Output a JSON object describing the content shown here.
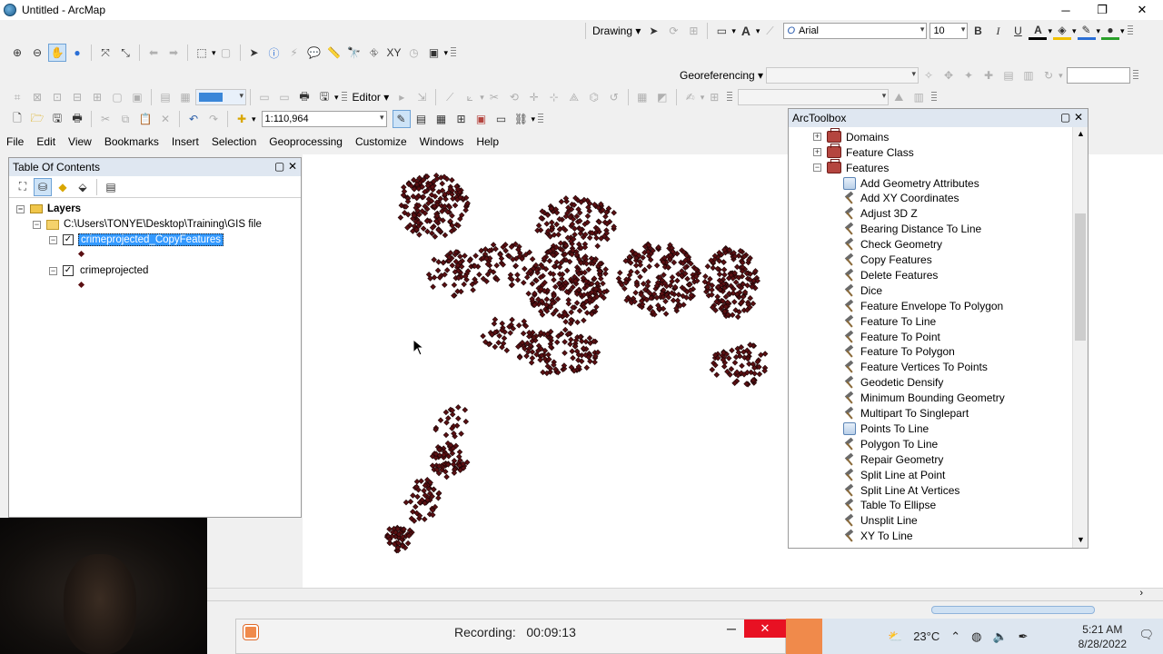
{
  "window": {
    "title": "Untitled - ArcMap",
    "minimize": "─",
    "restore": "❐",
    "close": "✕"
  },
  "drawing_toolbar": {
    "drawing_label": "Drawing",
    "font_name": "Arial",
    "font_size": "10",
    "bold": "B",
    "italic": "I",
    "underline": "U"
  },
  "georef_toolbar": {
    "label": "Georeferencing"
  },
  "editor_toolbar": {
    "label": "Editor"
  },
  "standard_toolbar": {
    "scale": "1:110,964"
  },
  "menu": [
    "File",
    "Edit",
    "View",
    "Bookmarks",
    "Insert",
    "Selection",
    "Geoprocessing",
    "Customize",
    "Windows",
    "Help"
  ],
  "toc": {
    "title": "Table Of Contents",
    "layers_root": "Layers",
    "folder_path": "C:\\Users\\TONYE\\Desktop\\Training\\GIS file",
    "layers": [
      {
        "name": "crimeprojected_CopyFeatures",
        "checked": true,
        "selected": true
      },
      {
        "name": "crimeprojected",
        "checked": true,
        "selected": false
      }
    ]
  },
  "arctoolbox": {
    "title": "ArcToolbox",
    "toolsets": [
      {
        "name": "Domains",
        "expanded": false
      },
      {
        "name": "Feature Class",
        "expanded": false
      },
      {
        "name": "Features",
        "expanded": true
      }
    ],
    "tools": [
      {
        "name": "Add Geometry Attributes",
        "icon": "script-icon"
      },
      {
        "name": "Add XY Coordinates",
        "icon": "hammer-icon"
      },
      {
        "name": "Adjust 3D Z",
        "icon": "hammer-icon"
      },
      {
        "name": "Bearing Distance To Line",
        "icon": "hammer-icon"
      },
      {
        "name": "Check Geometry",
        "icon": "hammer-icon"
      },
      {
        "name": "Copy Features",
        "icon": "hammer-icon"
      },
      {
        "name": "Delete Features",
        "icon": "hammer-icon"
      },
      {
        "name": "Dice",
        "icon": "hammer-icon"
      },
      {
        "name": "Feature Envelope To Polygon",
        "icon": "hammer-icon"
      },
      {
        "name": "Feature To Line",
        "icon": "hammer-icon"
      },
      {
        "name": "Feature To Point",
        "icon": "hammer-icon"
      },
      {
        "name": "Feature To Polygon",
        "icon": "hammer-icon"
      },
      {
        "name": "Feature Vertices To Points",
        "icon": "hammer-icon"
      },
      {
        "name": "Geodetic Densify",
        "icon": "hammer-icon"
      },
      {
        "name": "Minimum Bounding Geometry",
        "icon": "hammer-icon"
      },
      {
        "name": "Multipart To Singlepart",
        "icon": "hammer-icon"
      },
      {
        "name": "Points To Line",
        "icon": "script-icon"
      },
      {
        "name": "Polygon To Line",
        "icon": "hammer-icon"
      },
      {
        "name": "Repair Geometry",
        "icon": "hammer-icon"
      },
      {
        "name": "Split Line at Point",
        "icon": "hammer-icon"
      },
      {
        "name": "Split Line At Vertices",
        "icon": "hammer-icon"
      },
      {
        "name": "Table To Ellipse",
        "icon": "hammer-icon"
      },
      {
        "name": "Unsplit Line",
        "icon": "hammer-icon"
      },
      {
        "name": "XY To Line",
        "icon": "hammer-icon"
      }
    ]
  },
  "map": {
    "point_color": "#5a0f12",
    "outline_color": "#1a0506"
  },
  "recording": {
    "label": "Recording:",
    "time": "00:09:13"
  },
  "taskbar": {
    "temperature": "23°C",
    "time": "5:21 AM",
    "date": "8/28/2022"
  }
}
